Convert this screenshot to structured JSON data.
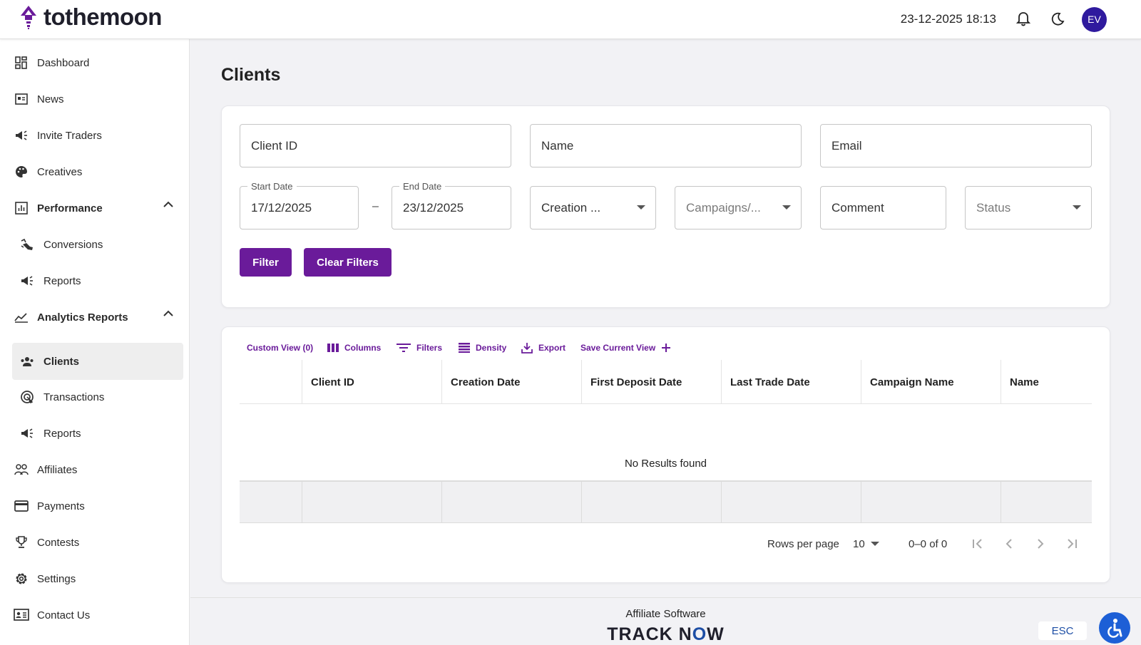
{
  "header": {
    "brand": "tothemoon",
    "datetime": "23-12-2025 18:13",
    "avatar_initials": "EV",
    "accent": "#6a1b9a",
    "avatar_color": "#2f1a9e"
  },
  "sidebar": {
    "items": [
      {
        "label": "Dashboard",
        "icon": "dashboard-icon"
      },
      {
        "label": "News",
        "icon": "news-icon"
      },
      {
        "label": "Invite Traders",
        "icon": "megaphone-icon"
      },
      {
        "label": "Creatives",
        "icon": "palette-icon"
      },
      {
        "label": "Performance",
        "icon": "chart-box-icon",
        "expanded": true
      },
      {
        "label": "Conversions",
        "icon": "conversions-icon"
      },
      {
        "label": "Reports",
        "icon": "megaphone-icon"
      },
      {
        "label": "Analytics Reports",
        "icon": "line-chart-icon",
        "expanded": true
      },
      {
        "label": "Clients",
        "icon": "people-icon",
        "active": true
      },
      {
        "label": "Transactions",
        "icon": "target-icon"
      },
      {
        "label": "Reports",
        "icon": "megaphone-icon"
      },
      {
        "label": "Affiliates",
        "icon": "group-icon"
      },
      {
        "label": "Payments",
        "icon": "card-icon"
      },
      {
        "label": "Contests",
        "icon": "trophy-icon"
      },
      {
        "label": "Settings",
        "icon": "gear-icon"
      },
      {
        "label": "Contact Us",
        "icon": "contact-icon"
      }
    ]
  },
  "page": {
    "title": "Clients"
  },
  "filters": {
    "client_id": "Client ID",
    "name": "Name",
    "email": "Email",
    "start_date_label": "Start Date",
    "start_date": "17/12/2025",
    "date_separator": "–",
    "end_date_label": "End Date",
    "end_date": "23/12/2025",
    "creation": "Creation ...",
    "campaigns": "Campaigns/...",
    "comment": "Comment",
    "status": "Status",
    "filter_button": "Filter",
    "clear_button": "Clear Filters"
  },
  "grid": {
    "toolbar": {
      "custom_view": "Custom View (0)",
      "columns": "Columns",
      "filters": "Filters",
      "density": "Density",
      "export": "Export",
      "save_view": "Save Current View"
    },
    "columns": [
      "Client ID",
      "Creation Date",
      "First Deposit Date",
      "Last Trade Date",
      "Campaign Name",
      "Name"
    ],
    "empty_message": "No Results found",
    "pagination": {
      "rows_label": "Rows per page",
      "rows_value": "10",
      "range": "0–0 of 0"
    }
  },
  "footer": {
    "label": "Affiliate Software",
    "brand_a": "TRACK N",
    "brand_b": "O",
    "brand_c": "W"
  },
  "overlay": {
    "esc": "ESC"
  }
}
